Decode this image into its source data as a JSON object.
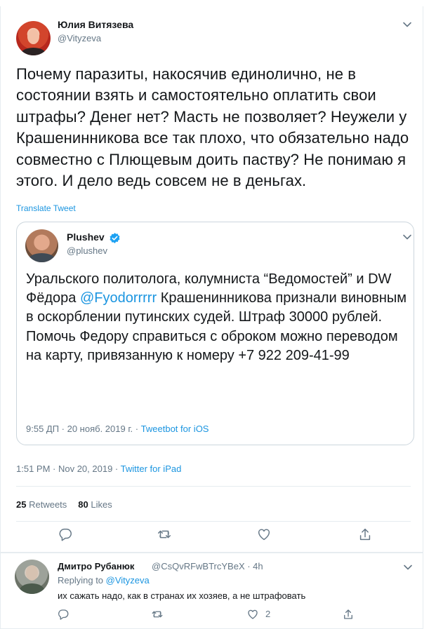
{
  "tweet": {
    "author_name": "Юлия Витязева",
    "author_handle": "@Vityzeva",
    "text": "Почему паразиты, накосячив единолично, не в состоянии взять и самостоятельно оплатить свои штрафы? Денег нет? Масть не позволяет? Неужели у Крашенинникова все так плохо, что обязательно надо совместно с Плющевым доить паству? Не понимаю я этого. И дело ведь совсем не в деньгах.",
    "translate_label": "Translate Tweet",
    "time": "1:51 PM · Nov 20, 2019 · ",
    "client": "Twitter for iPad",
    "retweets_count": "25",
    "retweets_label": "Retweets",
    "likes_count": "80",
    "likes_label": "Likes"
  },
  "quote": {
    "author_name": "Plushev",
    "author_handle": "@plushev",
    "text_before_mention": "Уральского политолога, колумниста  “Ведомостей” и DW Фёдора ",
    "mention": "@Fyodorrrrr",
    "text_after_mention": " Крашенинникова признали виновным в оскорблении путинских судей. Штраф 30000 рублей.",
    "text_line2": "Помочь Федору  справиться с оброком можно переводом на карту, привязанную к номеру +7 922 209-41-99",
    "time": "9:55 ДП · 20 нояб. 2019 г. · ",
    "client": "Tweetbot for iOS"
  },
  "reply": {
    "author_name": "Дмитро Рубанюк",
    "author_handle": "@CsQvRFwBTrcYBeX · 4h",
    "replying_prefix": "Replying to ",
    "replying_to": "@Vityzeva",
    "text": "их сажать надо, как в странах их хозяев, а не штрафовать",
    "like_count": "2"
  },
  "colors": {
    "link": "#1b95e0",
    "secondary": "#657786",
    "primary": "#14171a",
    "border": "#e6ecf0",
    "verified": "#1da1f2"
  },
  "icons": [
    "chevron-down-icon",
    "verified-icon",
    "reply-icon",
    "retweet-icon",
    "like-icon",
    "share-icon"
  ]
}
